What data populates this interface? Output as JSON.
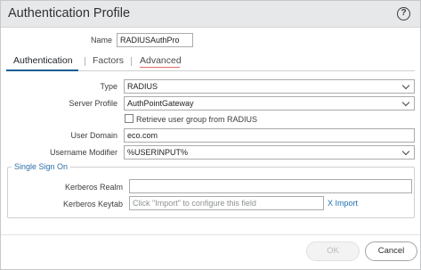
{
  "dialog": {
    "title": "Authentication Profile",
    "help_symbol": "?"
  },
  "name_field": {
    "label": "Name",
    "value": "RADIUSAuthPro"
  },
  "tabs": [
    {
      "label": "Authentication",
      "active": true
    },
    {
      "label": "Factors",
      "active": false
    },
    {
      "label": "Advanced",
      "active": false
    }
  ],
  "type_field": {
    "label": "Type",
    "value": "RADIUS"
  },
  "server_profile_field": {
    "label": "Server Profile",
    "value": "AuthPointGateway"
  },
  "retrieve_group_checkbox": {
    "label": "Retrieve user group from RADIUS",
    "checked": false
  },
  "user_domain_field": {
    "label": "User Domain",
    "value": "eco.com"
  },
  "username_modifier_field": {
    "label": "Username Modifier",
    "value": "%USERINPUT%"
  },
  "single_sign_on": {
    "title": "Single Sign On",
    "kerberos_realm": {
      "label": "Kerberos Realm",
      "value": ""
    },
    "kerberos_keytab": {
      "label": "Kerberos Keytab",
      "placeholder": "Click \"Import\" to configure this field"
    },
    "import_label": "X  Import"
  },
  "footer": {
    "ok_label": "OK",
    "cancel_label": "Cancel"
  },
  "colors": {
    "accent": "#1b5d97",
    "link": "#1e6fb3",
    "titlebar": "#e7e8e9"
  }
}
